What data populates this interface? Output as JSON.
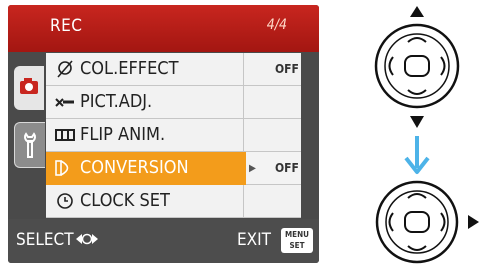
{
  "menu": {
    "title": "REC",
    "page": "4/4",
    "items": [
      {
        "label": "COL.EFFECT",
        "value": "OFF",
        "icon": "color-effect-icon"
      },
      {
        "label": "PICT.ADJ.",
        "value": "",
        "icon": "picture-adjust-icon"
      },
      {
        "label": "FLIP ANIM.",
        "value": "",
        "icon": "flip-animation-icon"
      },
      {
        "label": "CONVERSION",
        "value": "OFF",
        "icon": "conversion-icon",
        "selected": true
      },
      {
        "label": "CLOCK SET",
        "value": "",
        "icon": "clock-icon"
      }
    ],
    "footer": {
      "select": "SELECT",
      "exit": "EXIT",
      "menu_line1": "MENU",
      "menu_line2": "SET"
    }
  },
  "colors": {
    "header": "#c8261f",
    "highlight": "#f39c1b",
    "arrow": "#4db3e8"
  }
}
